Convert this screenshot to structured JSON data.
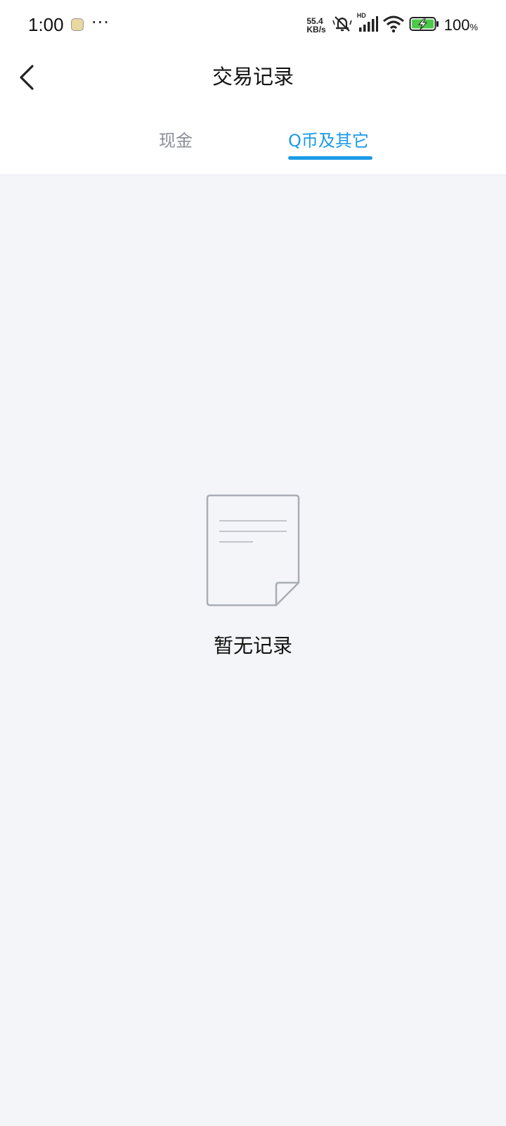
{
  "status_bar": {
    "time": "1:00",
    "more": "···",
    "net_speed_value": "55.4",
    "net_speed_unit": "KB/s",
    "signal_label": "HD",
    "battery_percent": "100",
    "battery_percent_sign": "%",
    "icons": [
      "app-notification-icon",
      "mute-icon",
      "signal-icon",
      "wifi-icon",
      "battery-charging-icon"
    ]
  },
  "header": {
    "title": "交易记录",
    "back_icon": "chevron-left-icon"
  },
  "tabs": [
    {
      "label": "现金",
      "active": false
    },
    {
      "label": "Q币及其它",
      "active": true
    }
  ],
  "empty_state": {
    "icon": "document-icon",
    "message": "暂无记录"
  },
  "colors": {
    "accent": "#1a9be6",
    "background": "#f3f5f9",
    "header_bg": "#ffffff",
    "inactive_tab": "#8b8f97"
  }
}
